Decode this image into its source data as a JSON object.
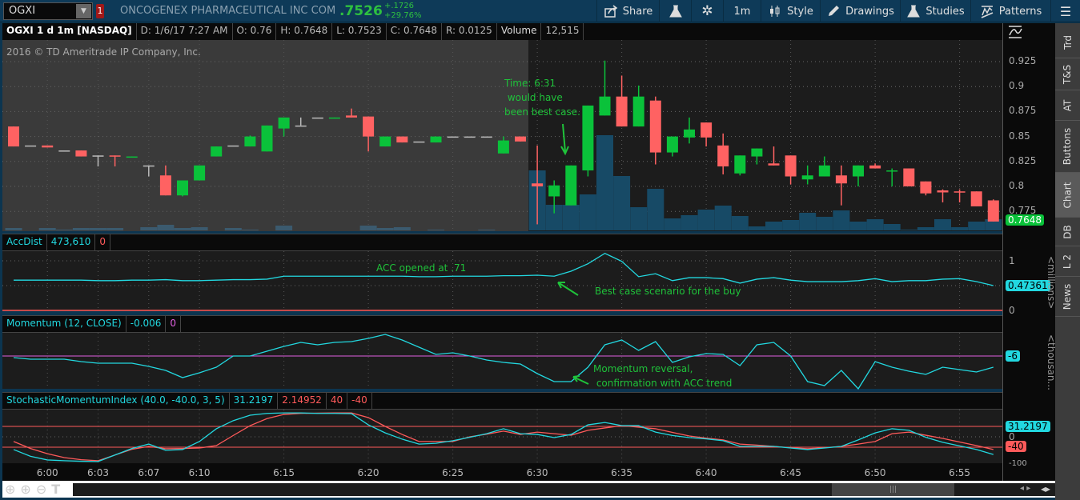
{
  "toolbar": {
    "symbol": "OGXI",
    "alert_count": "1",
    "company": "ONCOGENEX PHARMACEUTICAL INC COM",
    "last": ".7526",
    "change": "+.1726",
    "change_pct": "+29.76%",
    "share": "Share",
    "aggregation": "1m",
    "style": "Style",
    "drawings": "Drawings",
    "studies": "Studies",
    "patterns": "Patterns"
  },
  "info": {
    "title": "OGXI 1 d 1m [NASDAQ]",
    "date": "D: 1/6/17 7:27 AM",
    "open": "O: 0.76",
    "high": "H: 0.7648",
    "low": "L: 0.7523",
    "close": "C: 0.7648",
    "range": "R: 0.0125",
    "volume_label": "Volume",
    "volume": "12,515"
  },
  "copyright": "2016 © TD Ameritrade IP Company, Inc.",
  "price_axis": {
    "ticks": [
      "0.925",
      "0.9",
      "0.875",
      "0.85",
      "0.825",
      "0.8",
      "0.775"
    ],
    "last_badge": "0.7648"
  },
  "annotations": {
    "best_case_time": "Time: 6:31\n would have\nbeen best case.",
    "acc_opened": "ACC opened at .71",
    "best_case_buy": "Best case scenario for the buy",
    "momentum_reversal": "Momentum reversal,\n confirmation with ACC trend"
  },
  "colors": {
    "up": "#0ac23a",
    "down": "#ff6262",
    "doji": "#bbbbbb",
    "volume": "#174a66",
    "cyan": "#22d8e0",
    "red": "#ff5a5a",
    "magenta": "#e060e0"
  },
  "chart_data": {
    "type": "candlestick",
    "symbol": "OGXI",
    "ylim": [
      0.76,
      0.93
    ],
    "times": [
      "5:58",
      "5:59",
      "6:00",
      "6:01",
      "6:02",
      "6:03",
      "6:04",
      "6:05",
      "6:06",
      "6:07",
      "6:08",
      "6:09",
      "6:10",
      "6:11",
      "6:12",
      "6:13",
      "6:14",
      "6:15",
      "6:16",
      "6:17",
      "6:18",
      "6:19",
      "6:20",
      "6:21",
      "6:22",
      "6:23",
      "6:24",
      "6:25",
      "6:26",
      "6:27",
      "6:28",
      "6:29",
      "6:30",
      "6:31",
      "6:32",
      "6:33",
      "6:34",
      "6:35",
      "6:36",
      "6:37",
      "6:38",
      "6:39",
      "6:40",
      "6:41",
      "6:42",
      "6:43",
      "6:44",
      "6:45",
      "6:46",
      "6:47",
      "6:48",
      "6:49",
      "6:50",
      "6:51",
      "6:52",
      "6:53",
      "6:54",
      "6:55",
      "6:56"
    ],
    "ohlc": [
      [
        0.86,
        0.86,
        0.84,
        0.84
      ],
      [
        0.841,
        0.841,
        0.841,
        0.841
      ],
      [
        0.841,
        0.841,
        0.839,
        0.839
      ],
      [
        0.836,
        0.836,
        0.836,
        0.836
      ],
      [
        0.836,
        0.836,
        0.83,
        0.83
      ],
      [
        0.831,
        0.831,
        0.82,
        0.831
      ],
      [
        0.831,
        0.831,
        0.82,
        0.8305
      ],
      [
        0.8295,
        0.83,
        0.8295,
        0.83
      ],
      [
        0.821,
        0.821,
        0.81,
        0.821
      ],
      [
        0.811,
        0.821,
        0.791,
        0.791
      ],
      [
        0.791,
        0.806,
        0.79,
        0.806
      ],
      [
        0.806,
        0.821,
        0.806,
        0.821
      ],
      [
        0.83,
        0.84,
        0.83,
        0.84
      ],
      [
        0.841,
        0.841,
        0.841,
        0.841
      ],
      [
        0.84,
        0.851,
        0.84,
        0.85
      ],
      [
        0.835,
        0.861,
        0.835,
        0.861
      ],
      [
        0.858,
        0.869,
        0.85,
        0.869
      ],
      [
        0.861,
        0.869,
        0.861,
        0.861
      ],
      [
        0.869,
        0.869,
        0.869,
        0.869
      ],
      [
        0.8685,
        0.869,
        0.8685,
        0.869
      ],
      [
        0.871,
        0.878,
        0.869,
        0.869
      ],
      [
        0.87,
        0.87,
        0.835,
        0.85
      ],
      [
        0.84,
        0.85,
        0.84,
        0.85
      ],
      [
        0.85,
        0.85,
        0.844,
        0.844
      ],
      [
        0.845,
        0.845,
        0.845,
        0.845
      ],
      [
        0.844,
        0.85,
        0.844,
        0.85
      ],
      [
        0.85,
        0.85,
        0.85,
        0.85
      ],
      [
        0.85,
        0.85,
        0.85,
        0.85
      ],
      [
        0.85,
        0.85,
        0.85,
        0.85
      ],
      [
        0.833,
        0.85,
        0.833,
        0.846
      ],
      [
        0.85,
        0.85,
        0.845,
        0.845
      ],
      [
        0.803,
        0.841,
        0.762,
        0.8
      ],
      [
        0.79,
        0.806,
        0.773,
        0.801
      ],
      [
        0.781,
        0.821,
        0.781,
        0.821
      ],
      [
        0.816,
        0.881,
        0.81,
        0.881
      ],
      [
        0.871,
        0.926,
        0.871,
        0.89
      ],
      [
        0.89,
        0.911,
        0.86,
        0.86
      ],
      [
        0.86,
        0.901,
        0.86,
        0.89
      ],
      [
        0.886,
        0.89,
        0.822,
        0.834
      ],
      [
        0.834,
        0.85,
        0.83,
        0.85
      ],
      [
        0.849,
        0.869,
        0.843,
        0.857
      ],
      [
        0.864,
        0.864,
        0.84,
        0.849
      ],
      [
        0.841,
        0.853,
        0.812,
        0.82
      ],
      [
        0.813,
        0.831,
        0.811,
        0.831
      ],
      [
        0.83,
        0.838,
        0.822,
        0.838
      ],
      [
        0.823,
        0.84,
        0.821,
        0.821
      ],
      [
        0.831,
        0.831,
        0.802,
        0.81
      ],
      [
        0.807,
        0.821,
        0.802,
        0.811
      ],
      [
        0.81,
        0.83,
        0.81,
        0.821
      ],
      [
        0.811,
        0.821,
        0.781,
        0.803
      ],
      [
        0.81,
        0.821,
        0.8,
        0.821
      ],
      [
        0.821,
        0.823,
        0.818,
        0.818
      ],
      [
        0.815,
        0.818,
        0.8,
        0.816
      ],
      [
        0.818,
        0.818,
        0.8,
        0.8
      ],
      [
        0.805,
        0.805,
        0.791,
        0.793
      ],
      [
        0.796,
        0.797,
        0.784,
        0.794
      ],
      [
        0.795,
        0.797,
        0.784,
        0.7945
      ],
      [
        0.795,
        0.795,
        0.78,
        0.78
      ],
      [
        0.786,
        0.787,
        0.7648,
        0.7648
      ]
    ],
    "volume": [
      2700,
      0,
      2700,
      900,
      2700,
      2700,
      2700,
      0,
      3600,
      6300,
      2700,
      3600,
      0,
      2700,
      900,
      0,
      5400,
      0,
      0,
      0,
      0,
      5400,
      2700,
      3600,
      0,
      900,
      0,
      0,
      900,
      0,
      0,
      67500,
      28800,
      28800,
      40500,
      107100,
      61200,
      26100,
      46800,
      13500,
      17100,
      23400,
      27900,
      16200,
      4500,
      9900,
      11700,
      19800,
      15300,
      22500,
      9900,
      12600,
      7200,
      900,
      3600,
      12600,
      3600,
      9900,
      12515
    ]
  },
  "time_axis": [
    {
      "label": "6:00",
      "i": 2
    },
    {
      "label": "6:03",
      "i": 5
    },
    {
      "label": "6:07",
      "i": 8
    },
    {
      "label": "6:10",
      "i": 11
    },
    {
      "label": "6:15",
      "i": 16
    },
    {
      "label": "6:20",
      "i": 21
    },
    {
      "label": "6:25",
      "i": 26
    },
    {
      "label": "6:30",
      "i": 31
    },
    {
      "label": "6:35",
      "i": 36
    },
    {
      "label": "6:40",
      "i": 41
    },
    {
      "label": "6:45",
      "i": 46
    },
    {
      "label": "6:50",
      "i": 51
    },
    {
      "label": "6:55",
      "i": 56
    }
  ],
  "studies": {
    "accdist": {
      "label": "AccDist",
      "value": "473,610",
      "zero": "0",
      "badge": "0.47361",
      "unit": "<millions>",
      "ticks": [
        "1",
        "0"
      ],
      "values": [
        0.61,
        0.61,
        0.61,
        0.61,
        0.61,
        0.6,
        0.6,
        0.61,
        0.61,
        0.62,
        0.6,
        0.6,
        0.61,
        0.62,
        0.62,
        0.63,
        0.69,
        0.69,
        0.69,
        0.69,
        0.69,
        0.69,
        0.69,
        0.69,
        0.68,
        0.68,
        0.69,
        0.69,
        0.69,
        0.7,
        0.7,
        0.71,
        0.69,
        0.79,
        0.94,
        1.15,
        0.99,
        0.68,
        0.74,
        0.6,
        0.66,
        0.66,
        0.64,
        0.55,
        0.63,
        0.66,
        0.61,
        0.58,
        0.58,
        0.58,
        0.6,
        0.64,
        0.58,
        0.6,
        0.6,
        0.63,
        0.64,
        0.58,
        0.5
      ]
    },
    "momentum": {
      "label": "Momentum (12, CLOSE)",
      "value": "-0.006",
      "zero": "0",
      "badge": "-6",
      "unit": "<thousan...",
      "values": [
        -2,
        -4,
        -4,
        -4,
        -7,
        -9,
        -9,
        -9,
        -13,
        -18,
        -27,
        -21,
        -14,
        0,
        0,
        6,
        12,
        17,
        14,
        17,
        18,
        22,
        27,
        20,
        11,
        2,
        4,
        0,
        -5,
        -8,
        -10,
        -22,
        -32,
        -32,
        -14,
        14,
        20,
        7,
        18,
        -8,
        -1,
        3,
        2,
        -12,
        14,
        17,
        0,
        -32,
        -37,
        -18,
        -41,
        -7,
        -14,
        -19,
        -23,
        -14,
        -17,
        -20,
        -14
      ]
    },
    "smi": {
      "label": "StochasticMomentumIndex (40.0, -40.0, 3, 5)",
      "value": "31.2197",
      "avg_value": "2.14952",
      "over": "40",
      "under": "-40",
      "badge_smi": "31.2197",
      "badge_under": "-40",
      "ticks": [
        "0",
        "-100"
      ],
      "smi": [
        -49,
        -75,
        -89,
        -92,
        -94,
        -95,
        -70,
        -45,
        -28,
        -52,
        -49,
        -18,
        31,
        62,
        83,
        90,
        92,
        92,
        90,
        90,
        89,
        46,
        15,
        -9,
        -28,
        -25,
        -15,
        -2,
        12,
        31,
        12,
        9,
        -3,
        9,
        46,
        55,
        43,
        43,
        18,
        5,
        -3,
        -8,
        -15,
        -37,
        -37,
        -37,
        -43,
        -49,
        -43,
        -37,
        -12,
        15,
        31,
        25,
        -2,
        -21,
        -35,
        -49,
        -68
      ],
      "avg": [
        -18,
        -45,
        -65,
        -80,
        -88,
        -92,
        -70,
        -48,
        -37,
        -46,
        -45,
        -43,
        -34,
        5,
        43,
        70,
        86,
        90,
        91,
        92,
        92,
        74,
        40,
        9,
        -18,
        -18,
        -18,
        0,
        10,
        22,
        9,
        18,
        12,
        6,
        25,
        34,
        43,
        37,
        31,
        17,
        3,
        -5,
        -12,
        -28,
        -32,
        -37,
        -42,
        -46,
        -42,
        -37,
        -28,
        -18,
        12,
        18,
        6,
        -6,
        -20,
        -34,
        -49
      ]
    }
  },
  "right_tabs": [
    "Trd",
    "T&S",
    "AT",
    "Buttons",
    "Chart",
    "DB",
    "L 2",
    "News"
  ]
}
